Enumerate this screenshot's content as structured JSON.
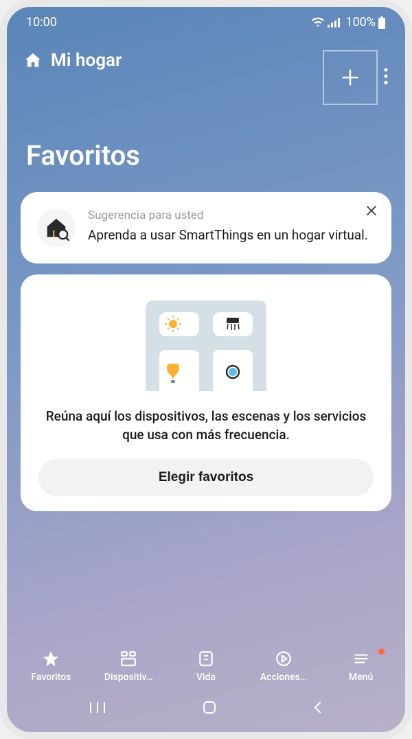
{
  "statusBar": {
    "time": "10:00",
    "battery": "100%"
  },
  "header": {
    "title": "Mi hogar"
  },
  "pageTitle": "Favoritos",
  "suggestionCard": {
    "label": "Sugerencia para usted",
    "description": "Aprenda a usar SmartThings en un hogar virtual."
  },
  "favoritesCard": {
    "description": "Reúna aquí los dispositivos, las escenas y los servicios que usa con más frecuencia.",
    "buttonLabel": "Elegir favoritos"
  },
  "bottomNav": {
    "items": [
      {
        "label": "Favoritos"
      },
      {
        "label": "Dispositiv…"
      },
      {
        "label": "Vida"
      },
      {
        "label": "Acciones…"
      },
      {
        "label": "Menú"
      }
    ]
  }
}
